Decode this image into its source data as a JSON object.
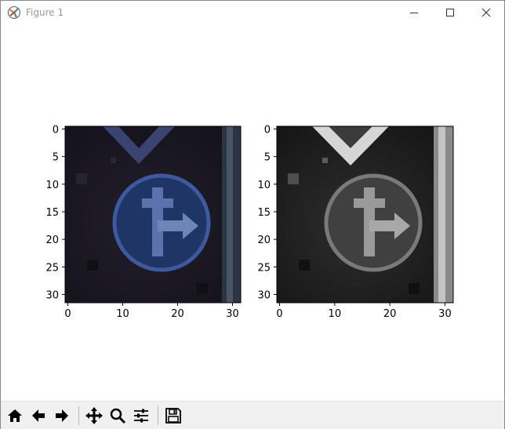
{
  "window": {
    "title": "Figure 1",
    "controls": [
      "minimize-icon",
      "maximize-icon",
      "close-icon"
    ]
  },
  "toolbar": {
    "buttons": [
      {
        "icon": "home-icon",
        "name": "home-button"
      },
      {
        "icon": "back-arrow-icon",
        "name": "back-button"
      },
      {
        "icon": "forward-arrow-icon",
        "name": "forward-button"
      },
      {
        "icon": "pan-icon",
        "name": "pan-button"
      },
      {
        "icon": "zoom-icon",
        "name": "zoom-button"
      },
      {
        "icon": "configure-subplots-icon",
        "name": "subplots-button"
      },
      {
        "icon": "save-icon",
        "name": "save-button"
      }
    ]
  },
  "chart_data": [
    {
      "type": "heatmap",
      "description_kind": "color image",
      "xticks": [
        "0",
        "10",
        "20",
        "30"
      ],
      "yticks": [
        "0",
        "5",
        "10",
        "15",
        "20",
        "25",
        "30"
      ],
      "xlim": [
        -0.5,
        31.5
      ],
      "ylim": [
        31.5,
        -0.5
      ],
      "colors": {
        "background": "#1c1a22",
        "sign_fill": "#1f3566",
        "sign_edge": "#3d5aa0",
        "arrow": "#6e85b8"
      }
    },
    {
      "type": "heatmap",
      "description_kind": "grayscale image",
      "xticks": [
        "0",
        "10",
        "20",
        "30"
      ],
      "yticks": [
        "0",
        "5",
        "10",
        "15",
        "20",
        "25",
        "30"
      ],
      "xlim": [
        -0.5,
        31.5
      ],
      "ylim": [
        31.5,
        -0.5
      ],
      "colors": {
        "background": "#262626",
        "sign_fill": "#444444",
        "sign_edge": "#7a7a7a",
        "arrow": "#a8a8a8"
      }
    }
  ]
}
